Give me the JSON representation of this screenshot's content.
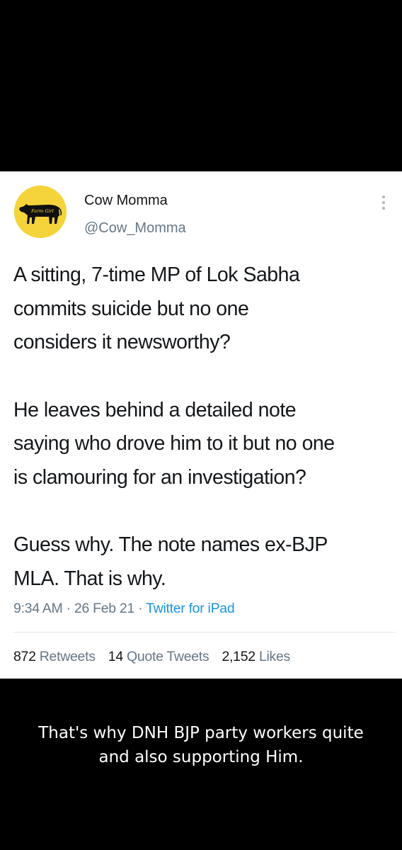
{
  "tweet": {
    "author": {
      "display_name": "Cow Momma",
      "handle": "@Cow_Momma",
      "avatar_text": "Farm Girl",
      "avatar_color": "#f5d33a"
    },
    "more_icon": "more-vertical-icon",
    "text_lines": [
      "A sitting, 7-time MP of Lok Sabha",
      "commits suicide but no one",
      "considers it newsworthy?",
      "He leaves behind a detailed note",
      "saying who drove him to it but no one",
      "is clamouring for an investigation?",
      "Guess why. The note names ex-BJP",
      "MLA. That is why."
    ],
    "time": "9:34 AM",
    "date": "26 Feb 21",
    "separator": "·",
    "source": "Twitter for iPad",
    "stats": {
      "retweets_count": "872",
      "retweets_label": "Retweets",
      "quotes_count": "14",
      "quotes_label": "Quote Tweets",
      "likes_count": "2,152",
      "likes_label": "Likes"
    },
    "colors": {
      "text": "#14171a",
      "secondary": "#657786",
      "link": "#1b95e0",
      "divider": "#e1e8ed"
    }
  },
  "caption": {
    "line1": "That's why DNH BJP  party workers quite",
    "line2": "and also supporting Him."
  }
}
